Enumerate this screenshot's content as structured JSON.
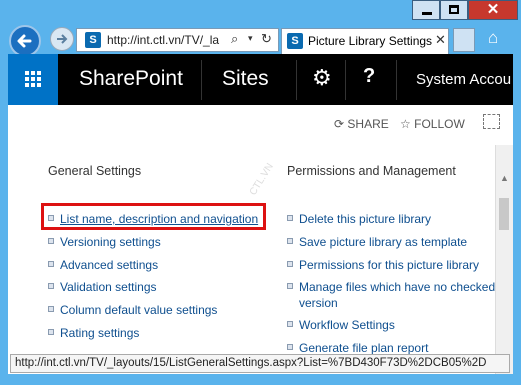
{
  "browser": {
    "address_url": "http://int.ctl.vn/TV/_la",
    "tab_title": "Picture Library Settings",
    "status_url": "http://int.ctl.vn/TV/_layouts/15/ListGeneralSettings.aspx?List=%7BD430F73D%2DCB05%2D"
  },
  "suite_bar": {
    "brand": "SharePoint",
    "sites": "Sites",
    "account": "System Accou"
  },
  "actions": {
    "share": "SHARE",
    "follow": "FOLLOW"
  },
  "watermark": "CTL.VN",
  "general": {
    "heading": "General Settings",
    "links": [
      "List name, description and navigation",
      "Versioning settings",
      "Advanced settings",
      "Validation settings",
      "Column default value settings",
      "Rating settings"
    ]
  },
  "permissions": {
    "heading": "Permissions and Management",
    "links": [
      "Delete this picture library",
      "Save picture library as template",
      "Permissions for this picture library",
      "Manage files which have no checked i",
      "version",
      "Workflow Settings",
      "Generate file plan report"
    ]
  }
}
